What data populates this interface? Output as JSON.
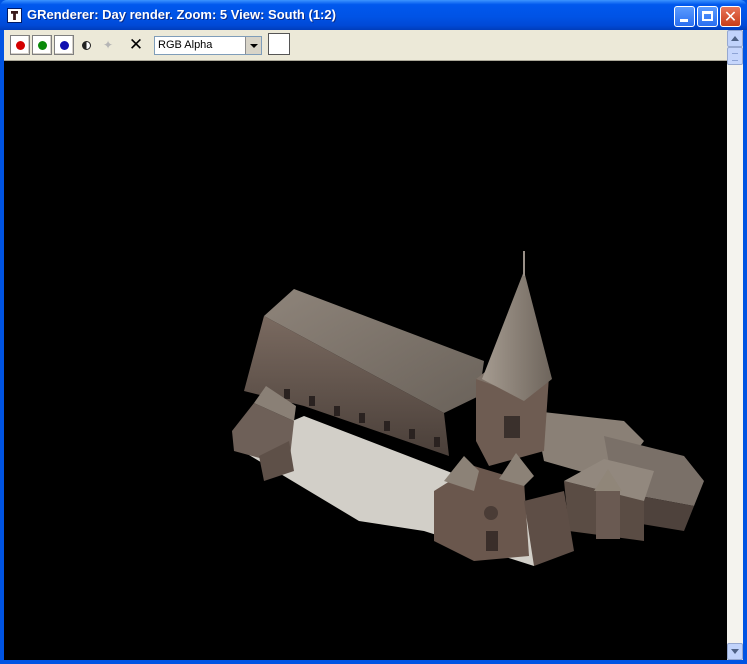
{
  "window": {
    "title": "GRenderer: Day render. Zoom: 5 View: South (1:2)",
    "app_icon": "grenderer-app-icon",
    "controls": {
      "minimize_icon": "minimize-icon",
      "maximize_icon": "maximize-icon",
      "close_icon": "close-icon"
    }
  },
  "toolbar": {
    "channel_buttons": [
      {
        "name": "red",
        "color": "#d40000",
        "icon": "red-dot-icon"
      },
      {
        "name": "green",
        "color": "#0a8a0a",
        "icon": "green-dot-icon"
      },
      {
        "name": "blue",
        "color": "#1010b0",
        "icon": "blue-dot-icon"
      }
    ],
    "contrast_icon": "contrast-half-circle-icon",
    "gray_icon": "grayscale-icon",
    "clear_icon": "close-x-icon",
    "channel_select": {
      "selected": "RGB Alpha"
    },
    "background_swatch_color": "#ffffff"
  },
  "viewport": {
    "background": "#000000",
    "content": "3D isometric render of a stone cathedral with central tower and spire"
  }
}
